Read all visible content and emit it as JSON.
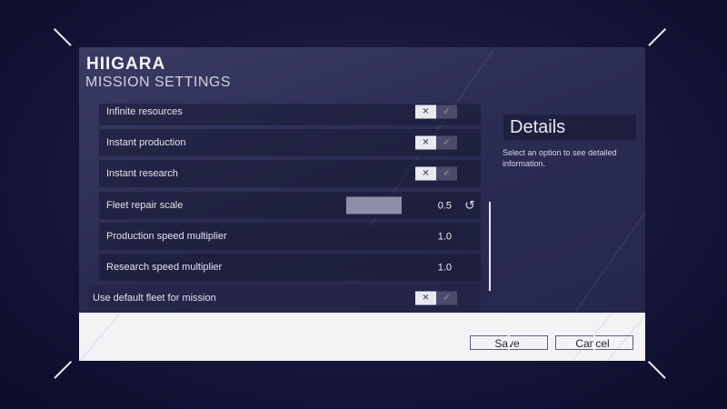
{
  "header": {
    "logo": "HIIGARA",
    "title": "MISSION SETTINGS"
  },
  "settings": {
    "toggles": [
      {
        "label": "Infinite resources",
        "x": "✕",
        "check": "✓"
      },
      {
        "label": "Instant production",
        "x": "✕",
        "check": "✓"
      },
      {
        "label": "Instant research",
        "x": "✕",
        "check": "✓"
      }
    ],
    "sliders": [
      {
        "label": "Fleet repair scale",
        "value": "0.5",
        "fill_fraction": 0.5
      },
      {
        "label": "Production speed multiplier",
        "value": "1.0"
      },
      {
        "label": "Research speed multiplier",
        "value": "1.0"
      }
    ],
    "default_fleet": {
      "label": "Use default fleet for mission",
      "x": "✕",
      "check": "✓"
    },
    "reset_icon": "↺"
  },
  "details": {
    "title": "Details",
    "text": "Select an option to see detailed information."
  },
  "footer": {
    "save_label": "Save",
    "cancel_label": "Cancel"
  },
  "colors": {
    "background": "#15163a",
    "panel": "#2f3058",
    "footer": "#f3f3f6",
    "toggle_off": "#e9eaf1",
    "slider_fill": "#8d8fa8"
  }
}
